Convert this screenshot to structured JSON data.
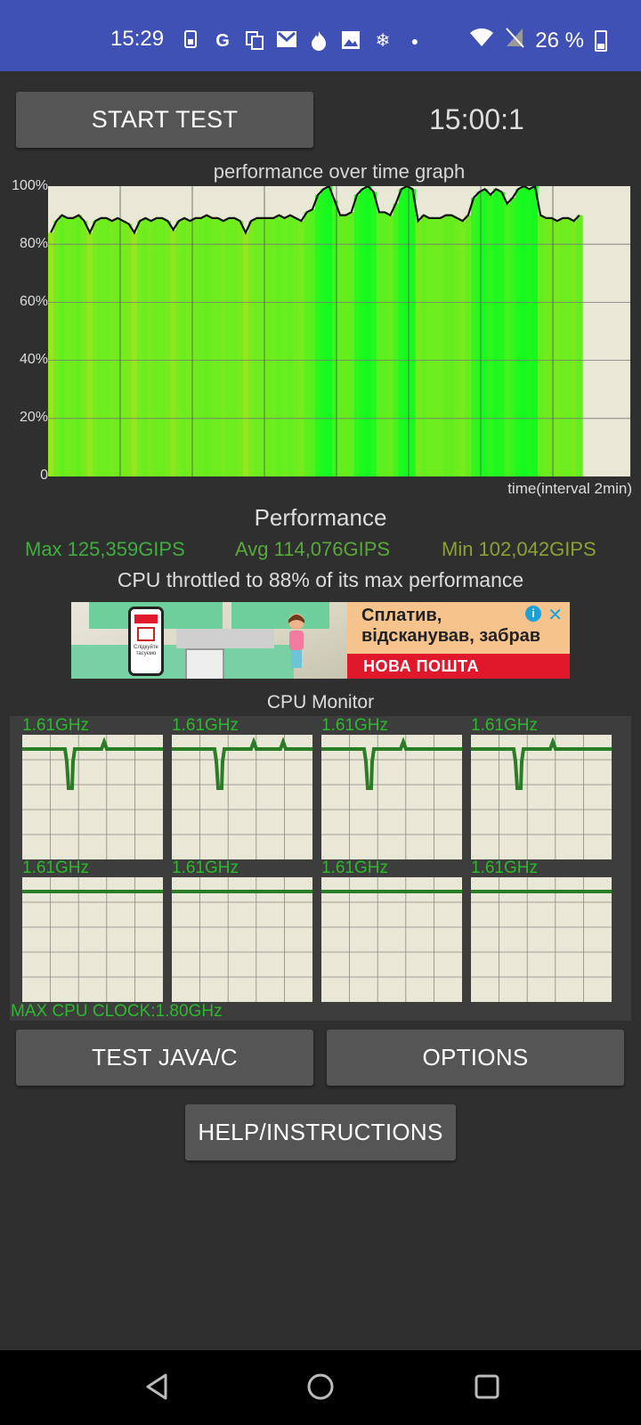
{
  "status_bar": {
    "time": "15:29",
    "icons": [
      "sim-icon",
      "google-icon",
      "copy-icon",
      "gmail-icon",
      "fire-icon",
      "image-icon",
      "snowflake-icon",
      "dot-icon"
    ],
    "battery_percent": "26 %"
  },
  "controls": {
    "start_label": "START TEST",
    "timer": "15:00:1"
  },
  "graph": {
    "title": "performance over time graph",
    "y_ticks": [
      "100%",
      "80%",
      "60%",
      "40%",
      "20%",
      "0"
    ],
    "x_label": "time(interval 2min)"
  },
  "performance": {
    "title": "Performance",
    "max": "Max 125,359GIPS",
    "avg": "Avg 114,076GIPS",
    "min": "Min 102,042GIPS",
    "throttle": "CPU throttled to 88% of its max performance",
    "colors": {
      "max": "#3fae3f",
      "avg": "#58a83a",
      "min": "#8aa233"
    }
  },
  "ad": {
    "headline_line1": "Сплатив,",
    "headline_line2": "відсканував, забрав",
    "brand": "НОВА ПОШТА",
    "phone_text": "Слідкуйте тасуємо"
  },
  "cpu_monitor": {
    "title": "CPU Monitor",
    "cores": [
      {
        "freq": "1.61GHz"
      },
      {
        "freq": "1.61GHz"
      },
      {
        "freq": "1.61GHz"
      },
      {
        "freq": "1.61GHz"
      },
      {
        "freq": "1.61GHz"
      },
      {
        "freq": "1.61GHz"
      },
      {
        "freq": "1.61GHz"
      },
      {
        "freq": "1.61GHz"
      }
    ],
    "max_clock": "MAX CPU CLOCK:1.80GHz"
  },
  "buttons": {
    "test_java": "TEST JAVA/C",
    "options": "OPTIONS",
    "help": "HELP/INSTRUCTIONS"
  },
  "chart_data": {
    "type": "area",
    "title": "performance over time graph",
    "xlabel": "time(interval 2min)",
    "ylabel": "",
    "ylim": [
      0,
      100
    ],
    "y_ticks": [
      "0",
      "20%",
      "40%",
      "60%",
      "80%",
      "100%"
    ],
    "x_interval_minutes": 2,
    "series": [
      {
        "values": [
          84,
          88,
          90,
          89,
          89,
          90,
          88,
          84,
          88,
          89,
          89,
          88,
          89,
          88,
          87,
          84,
          88,
          89,
          88,
          89,
          89,
          88,
          85,
          88,
          89,
          88,
          89,
          89,
          90,
          89,
          89,
          88,
          89,
          89,
          88,
          84,
          88,
          89,
          89,
          89,
          89,
          90,
          89,
          90,
          89,
          88,
          91,
          92,
          97,
          99,
          100,
          95,
          90,
          90,
          91,
          97,
          99,
          100,
          98,
          91,
          91,
          90,
          94,
          99,
          100,
          99,
          88,
          90,
          89,
          89,
          89,
          90,
          90,
          89,
          88,
          90,
          96,
          98,
          99,
          97,
          99,
          98,
          94,
          96,
          99,
          100,
          99,
          100,
          90,
          89,
          89,
          88,
          89,
          89,
          88,
          90
        ]
      }
    ],
    "grid": true
  }
}
